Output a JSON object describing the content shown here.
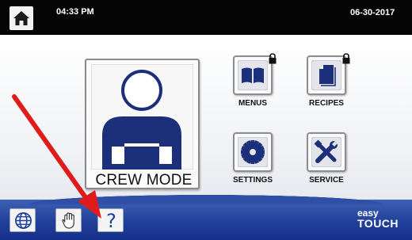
{
  "status_bar": {
    "time": "04:33 PM",
    "date": "06-30-2017",
    "home_icon": "home-icon"
  },
  "main": {
    "crew_mode": {
      "label": "CREW MODE",
      "icon": "person-icon"
    },
    "tiles": [
      {
        "label": "MENUS",
        "icon": "book-icon",
        "locked": true
      },
      {
        "label": "RECIPES",
        "icon": "document-icon",
        "locked": true
      },
      {
        "label": "SETTINGS",
        "icon": "gear-icon",
        "locked": false
      },
      {
        "label": "SERVICE",
        "icon": "tools-icon",
        "locked": false
      }
    ]
  },
  "bottom_bar": {
    "buttons": [
      {
        "name": "language",
        "icon": "globe-icon"
      },
      {
        "name": "cleaning",
        "icon": "hand-icon"
      },
      {
        "name": "help",
        "icon": "question-icon",
        "label": "?"
      }
    ],
    "logo": {
      "line1": "easy",
      "line2": "TOUCH"
    }
  },
  "annotation": {
    "type": "red-arrow",
    "color": "#e01b1b",
    "points_to": "help"
  },
  "colors": {
    "accent_blue": "#1d3f9a",
    "bar_blue": "#22409a",
    "background": "#f0f2f5"
  }
}
